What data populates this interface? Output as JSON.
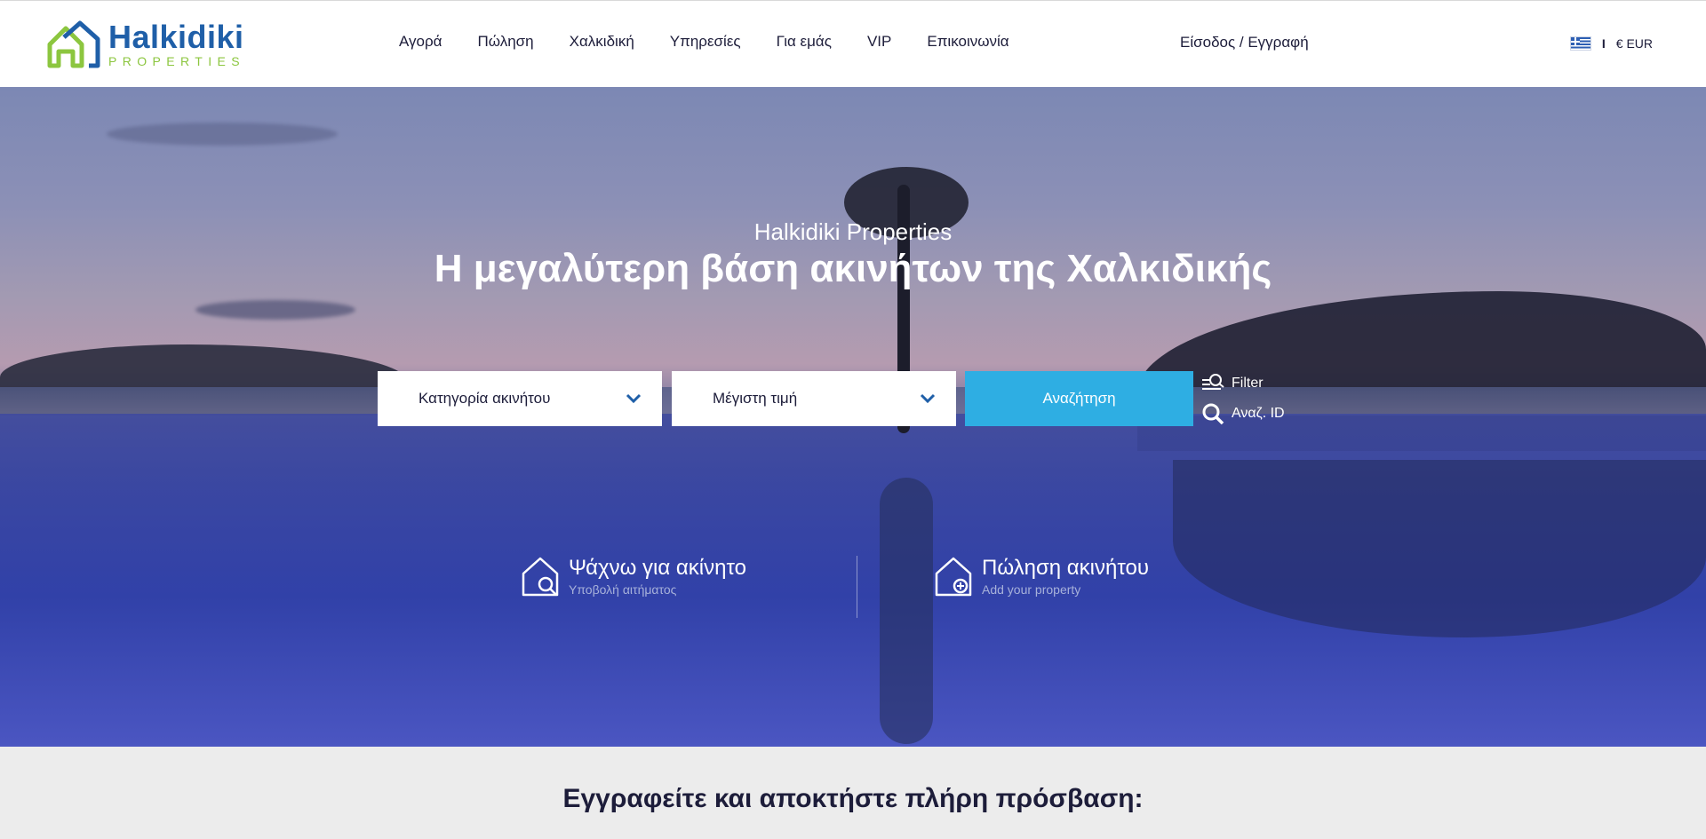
{
  "header": {
    "logo": {
      "name": "Halkidiki",
      "tagline": "PROPERTIES"
    },
    "nav": [
      {
        "label": "Αγορά"
      },
      {
        "label": "Πώληση"
      },
      {
        "label": "Χαλκιδική"
      },
      {
        "label": "Υπηρεσίες"
      },
      {
        "label": "Για εμάς"
      },
      {
        "label": "VIP"
      },
      {
        "label": "Επικοινωνία"
      }
    ],
    "login_label": "Είσοδος / Εγγραφή",
    "locale": {
      "flag_icon": "greek-flag-icon",
      "separator": "I",
      "currency": "€ EUR"
    }
  },
  "hero": {
    "subtitle": "Halkidiki Properties",
    "title": "Η μεγαλύτερη βάση ακινήτων της Χαλκιδικής",
    "search": {
      "category_label": "Κατηγορία ακινήτου",
      "price_label": "Μέγιστη τιμή",
      "button_label": "Αναζήτηση"
    },
    "aux": {
      "filter_label": "Filter",
      "id_search_label": "Αναζ. ID"
    },
    "cta": {
      "looking": {
        "title": "Ψάχνω για ακίνητο",
        "subtitle": "Υποβολή αιτήματος"
      },
      "sell": {
        "title": "Πώληση ακινήτου",
        "subtitle": "Add your property"
      }
    }
  },
  "band": {
    "title": "Εγγραφείτε και αποκτήστε πλήρη πρόσβαση:"
  },
  "colors": {
    "brand_blue": "#1f5fa8",
    "brand_green": "#8cc63f",
    "search_button": "#2eaee3",
    "band_bg": "#ececec"
  }
}
